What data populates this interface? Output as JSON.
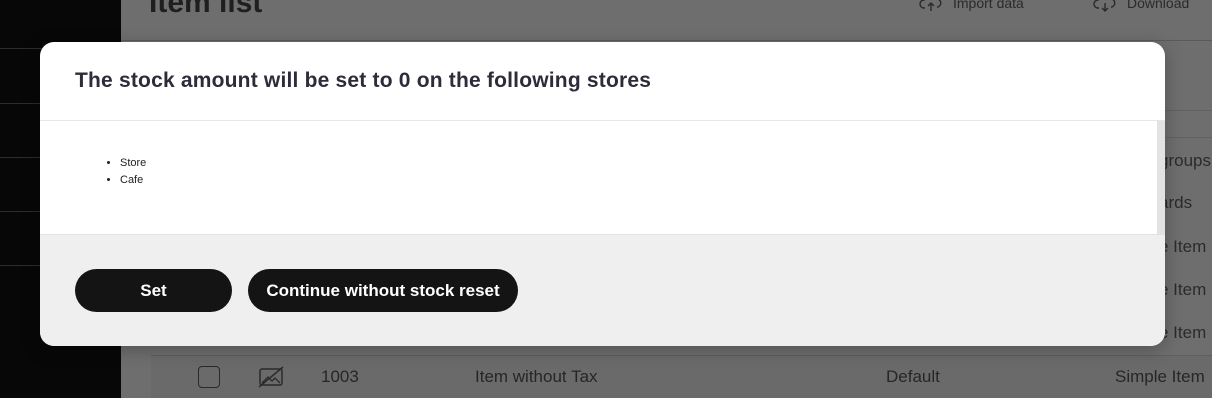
{
  "page": {
    "title": "Item list",
    "actions": [
      {
        "label": "Import data",
        "icon": "cloud-upload-icon"
      },
      {
        "label": "Download",
        "icon": "cloud-download-icon"
      }
    ],
    "right_column_snippets": [
      "groups",
      "ards",
      "e Item",
      "e Item",
      "e Item"
    ],
    "visible_row": {
      "code": "1003",
      "name": "Item without Tax",
      "group": "Default",
      "type": "Simple Item",
      "image_icon": "no-image-icon"
    }
  },
  "modal": {
    "title": "The stock amount will be set to 0 on the following stores",
    "stores": [
      "Store",
      "Cafe"
    ],
    "buttons": {
      "set": "Set",
      "continue": "Continue without stock reset"
    }
  },
  "colors": {
    "button_bg": "#141414",
    "button_text": "#ffffff",
    "footer_bg": "#efefef",
    "overlay_sidebar": "#070707"
  }
}
